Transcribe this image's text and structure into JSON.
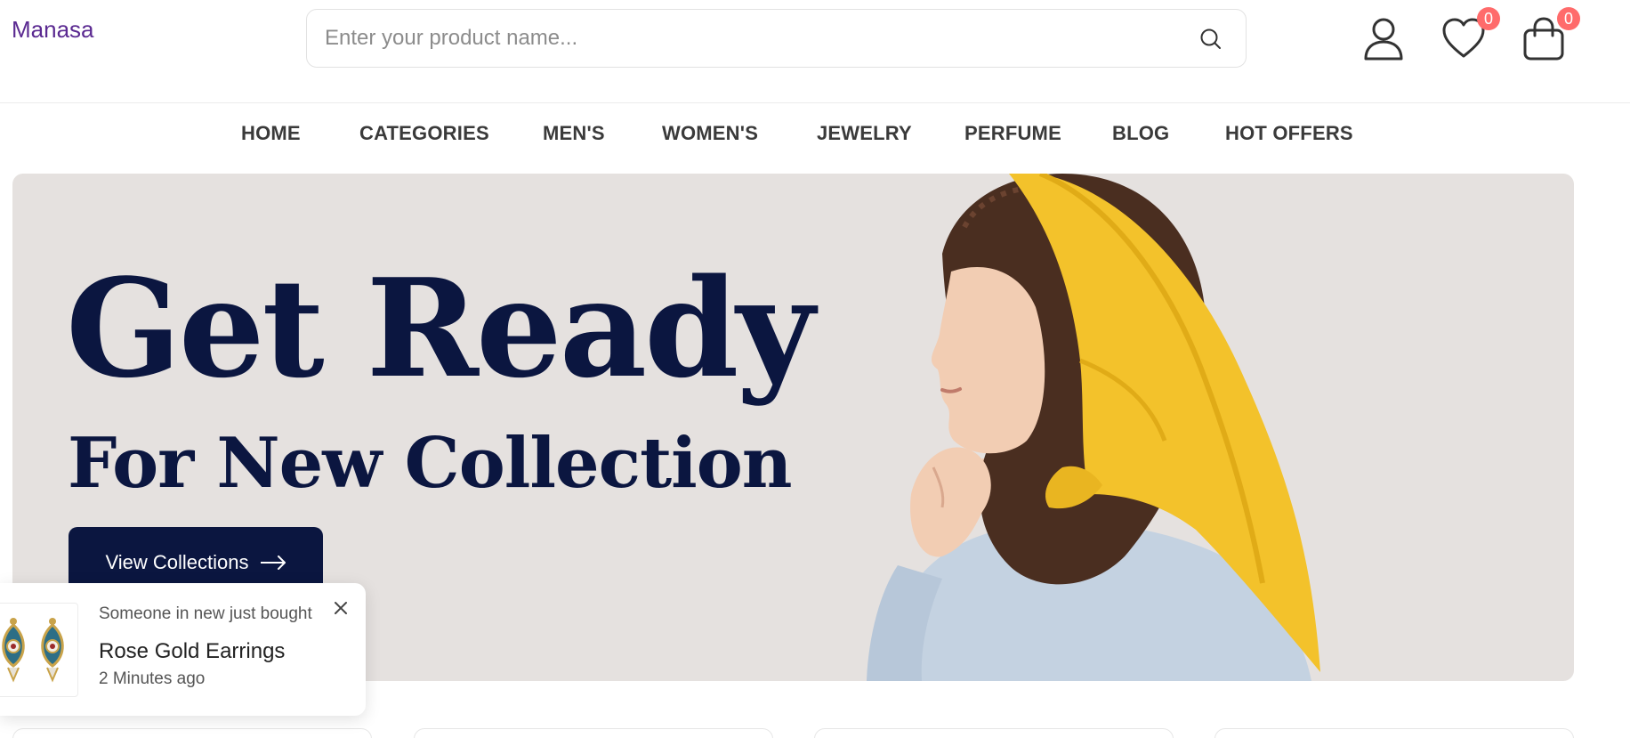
{
  "header": {
    "logo": "Manasa",
    "search": {
      "placeholder": "Enter your product name...",
      "value": ""
    },
    "wishlist_count": "0",
    "cart_count": "0"
  },
  "nav": {
    "items": [
      {
        "label": "HOME"
      },
      {
        "label": "CATEGORIES"
      },
      {
        "label": "MEN'S"
      },
      {
        "label": "WOMEN'S"
      },
      {
        "label": "JEWELRY"
      },
      {
        "label": "PERFUME"
      },
      {
        "label": "BLOG"
      },
      {
        "label": "HOT OFFERS"
      }
    ]
  },
  "hero": {
    "title": "Get Ready",
    "subtitle": "For New Collection",
    "button_label": "View Collections"
  },
  "toast": {
    "message": "Someone in new just bought",
    "product": "Rose Gold Earrings",
    "time": "2 Minutes ago"
  },
  "colors": {
    "brand": "#5b2a91",
    "navy": "#0b1640",
    "badge": "#ff6b6b",
    "scarf": "#f3c22b"
  },
  "icons": [
    "search-icon",
    "user-icon",
    "heart-icon",
    "bag-icon",
    "arrow-right-icon",
    "close-icon"
  ]
}
